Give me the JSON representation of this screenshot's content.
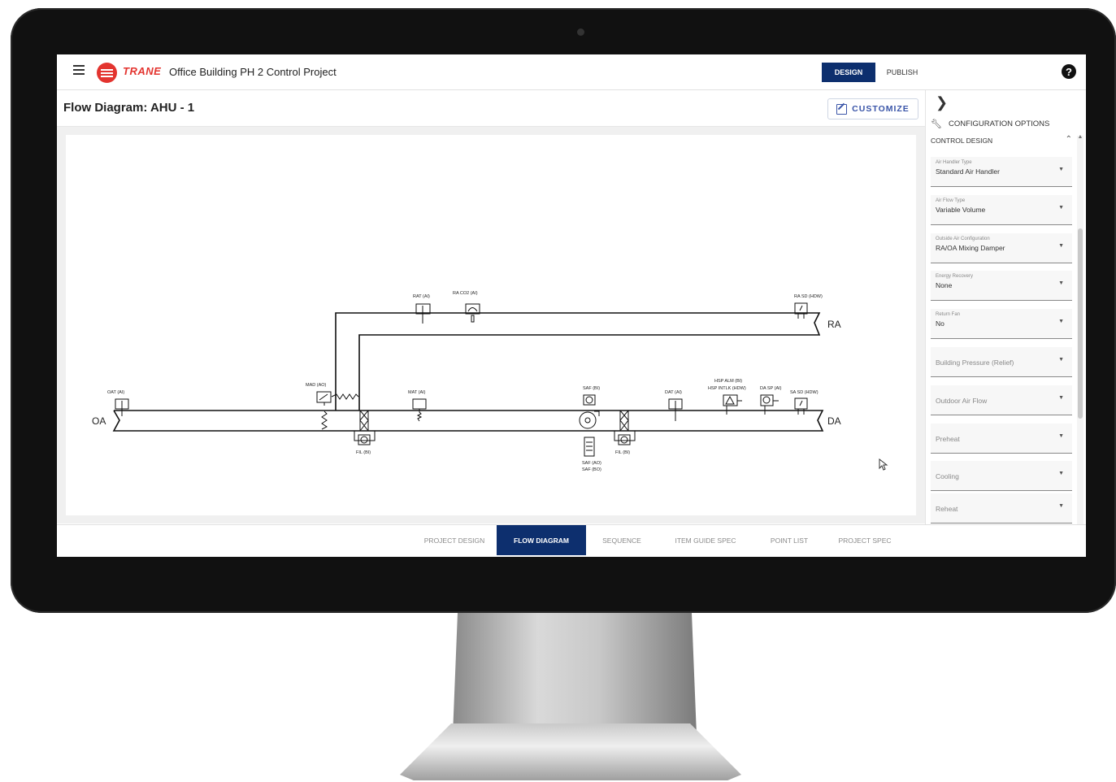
{
  "header": {
    "logo_text": "TRANE",
    "project_title": "Office Building PH 2 Control Project",
    "design_label": "DESIGN",
    "publish_label": "PUBLISH",
    "help_glyph": "?"
  },
  "page": {
    "title": "Flow Diagram: AHU - 1",
    "customize_label": "CUSTOMIZE"
  },
  "diagram": {
    "oa": "OA",
    "ra": "RA",
    "da": "DA",
    "rat": "RAT (AI)",
    "ra_co2": "RA CO2 (AI)",
    "ra_sd": "RA SD (HDW)",
    "oat": "OAT (AI)",
    "mad": "MAD (AO)",
    "mat": "MAT (AI)",
    "saf_bi": "SAF (BI)",
    "dat": "DAT (AI)",
    "hsp_alm": "HSP ALM (BI)",
    "hsp_intlk": "HSP INTLK (HDW)",
    "da_sp": "DA SP (AI)",
    "sa_sd": "SA SD (HDW)",
    "fil_1": "FIL (BI)",
    "fil_2": "FIL (BI)",
    "saf_ao": "SAF (AO)",
    "saf_bo": "SAF (BO)"
  },
  "config": {
    "header": "CONFIGURATION OPTIONS",
    "section": "CONTROL DESIGN",
    "fields": [
      {
        "label": "Air Handler Type",
        "value": "Standard Air Handler"
      },
      {
        "label": "Air Flow Type",
        "value": "Variable Volume"
      },
      {
        "label": "Outside Air Configuration",
        "value": "RA/OA Mixing Damper"
      },
      {
        "label": "Energy Recovery",
        "value": "None"
      },
      {
        "label": "Return Fan",
        "value": "No"
      },
      {
        "placeholder": "Building Pressure (Relief)"
      },
      {
        "placeholder": "Outdoor Air Flow"
      },
      {
        "placeholder": "Preheat"
      },
      {
        "placeholder": "Cooling"
      },
      {
        "placeholder": "Reheat"
      }
    ]
  },
  "tabs": {
    "project_design": "PROJECT DESIGN",
    "flow_diagram": "FLOW DIAGRAM",
    "sequence": "SEQUENCE",
    "item_guide_spec": "ITEM GUIDE SPEC",
    "point_list": "POINT LIST",
    "project_spec": "PROJECT SPEC"
  },
  "colors": {
    "brand": "#e3342f",
    "primary": "#0d2f6e",
    "accent": "#3a55a8"
  },
  "icons": [
    "menu-icon",
    "trane-logo-icon",
    "help-icon",
    "edit-icon",
    "chevron-right-icon",
    "wrench-icon",
    "chevron-up-icon",
    "caret-down-icon",
    "cursor-icon"
  ]
}
